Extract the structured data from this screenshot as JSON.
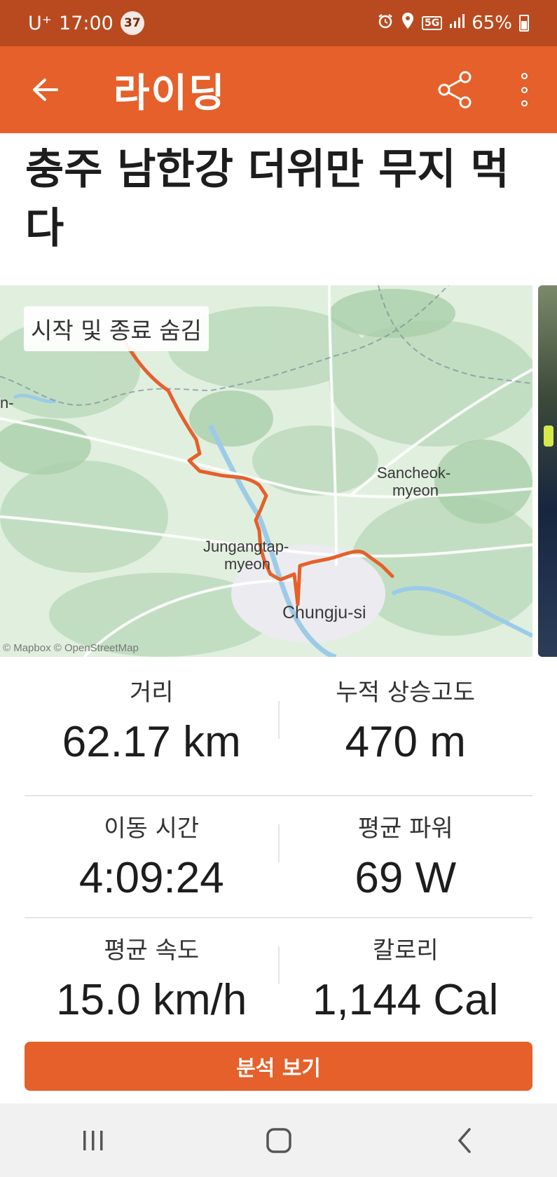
{
  "status_bar": {
    "carrier": "U⁺",
    "time": "17:00",
    "notification_count": "37",
    "network": "5G",
    "battery": "65%"
  },
  "app_bar": {
    "title": "라이딩"
  },
  "activity": {
    "title": "충주 남한강 더위만 무지 먹다"
  },
  "map": {
    "toggle_label": "시작 및 종료 숨김",
    "labels": {
      "sancheok": "Sancheok-",
      "sancheok2": "myeon",
      "jungang": "Jungangtap-",
      "jungang2": "myeon",
      "chungju": "Chungju-si",
      "west": "n-",
      "attribution": "© Mapbox © OpenStreetMap"
    },
    "route_color": "#e5602a"
  },
  "stats": [
    {
      "label": "거리",
      "value": "62.17 km"
    },
    {
      "label": "누적 상승고도",
      "value": "470 m"
    },
    {
      "label": "이동 시간",
      "value": "4:09:24"
    },
    {
      "label": "평균 파워",
      "value": "69 W"
    },
    {
      "label": "평균 속도",
      "value": "15.0 km/h"
    },
    {
      "label": "칼로리",
      "value": "1,144 Cal"
    }
  ],
  "actions": {
    "analysis_label": "분석 보기"
  },
  "colors": {
    "accent": "#e5602a",
    "status_bar": "#b94a1f"
  }
}
